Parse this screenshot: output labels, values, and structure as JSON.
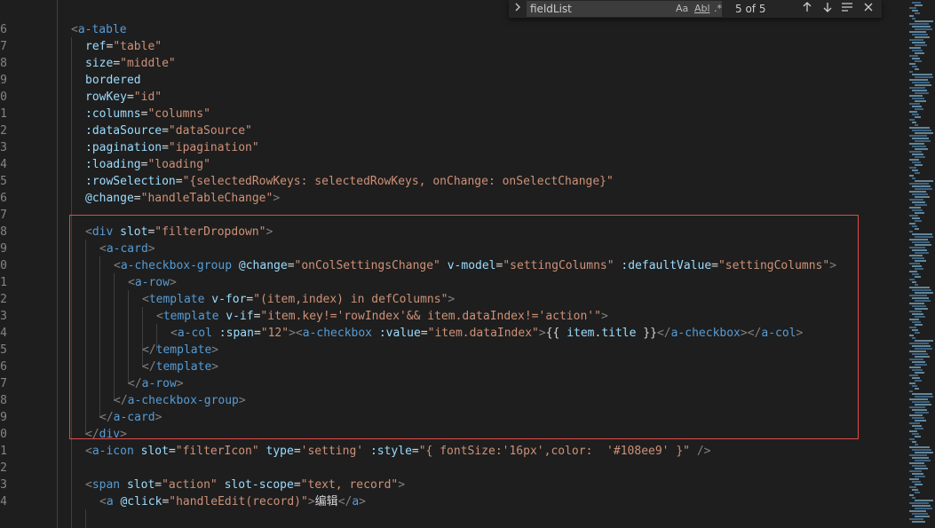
{
  "editor": {
    "line_numbers": [
      "6",
      "7",
      "8",
      "9",
      "0",
      "1",
      "2",
      "3",
      "4",
      "5",
      "6",
      "7",
      "8",
      "9",
      "0",
      "1",
      "2",
      "3",
      "4",
      "5",
      "6",
      "7",
      "8",
      "9",
      "0",
      "1",
      "2",
      "3",
      "4"
    ]
  },
  "find_widget": {
    "query": "fieldList",
    "option_case": "Aa",
    "option_word": "Abl",
    "option_regex": ".*",
    "result_count": "5 of 5"
  },
  "code_lines": [
    [
      "<a-table"
    ],
    [
      "ref=\"table\""
    ],
    [
      "size=\"middle\""
    ],
    [
      "bordered"
    ],
    [
      "rowKey=\"id\""
    ],
    [
      ":columns=\"columns\""
    ],
    [
      ":dataSource=\"dataSource\""
    ],
    [
      ":pagination=\"ipagination\""
    ],
    [
      ":loading=\"loading\""
    ],
    [
      ":rowSelection=\"{selectedRowKeys: selectedRowKeys, onChange: onSelectChange}\""
    ],
    [
      "@change=\"handleTableChange\">"
    ],
    [
      ""
    ],
    [
      "<div slot=\"filterDropdown\">"
    ],
    [
      "<a-card>"
    ],
    [
      "<a-checkbox-group @change=\"onColSettingsChange\" v-model=\"settingColumns\" :defaultValue=\"settingColumns\">"
    ],
    [
      "<a-row>"
    ],
    [
      "<template v-for=\"(item,index) in defColumns\">"
    ],
    [
      "<template v-if=\"item.key!='rowIndex'&& item.dataIndex!='action'\">"
    ],
    [
      "<a-col :span=\"12\"><a-checkbox :value=\"item.dataIndex\">{{ item.title }}</a-checkbox></a-col>"
    ],
    [
      "</template>"
    ],
    [
      "</template>"
    ],
    [
      "</a-row>"
    ],
    [
      "</a-checkbox-group>"
    ],
    [
      "</a-card>"
    ],
    [
      "</div>"
    ],
    [
      "<a-icon slot=\"filterIcon\" type='setting' :style=\"{ fontSize:'16px',color:  '#108ee9' }\" />"
    ],
    [
      ""
    ],
    [
      "<span slot=\"action\" slot-scope=\"text, record\">"
    ],
    [
      "<a @click=\"handleEdit(record)\">编辑</a>"
    ]
  ],
  "colors": {
    "background": "#1e1e1e",
    "tag": "#569cd6",
    "attribute": "#9cdcfe",
    "string": "#ce9178",
    "highlight_border": "#e04a4a"
  }
}
